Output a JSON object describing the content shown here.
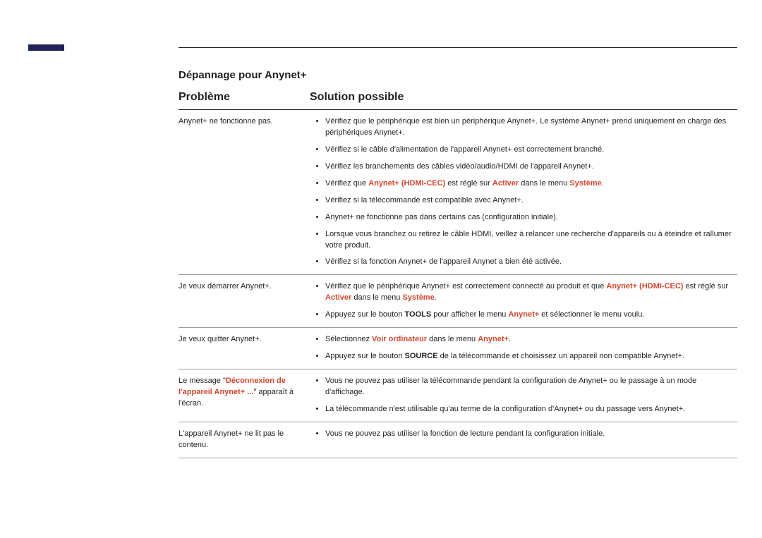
{
  "sectionTitle": "Dépannage pour Anynet+",
  "headers": {
    "problem": "Problème",
    "solution": "Solution possible"
  },
  "rows": [
    {
      "problem": [
        {
          "t": "Anynet+ ne fonctionne pas."
        }
      ],
      "solutions": [
        [
          {
            "t": "Vérifiez que le périphérique est bien un périphérique Anynet+. Le système Anynet+ prend uniquement en charge des périphériques Anynet+."
          }
        ],
        [
          {
            "t": "Vérifiez si le câble d'alimentation de l'appareil Anynet+ est correctement branché."
          }
        ],
        [
          {
            "t": "Vérifiez les branchements des câbles vidéo/audio/HDMI de l'appareil Anynet+."
          }
        ],
        [
          {
            "t": "Vérifiez que "
          },
          {
            "t": "Anynet+ (HDMI-CEC)",
            "hl": true
          },
          {
            "t": " est réglé sur "
          },
          {
            "t": "Activer",
            "hl": true
          },
          {
            "t": " dans le menu "
          },
          {
            "t": "Système",
            "hl": true
          },
          {
            "t": "."
          }
        ],
        [
          {
            "t": "Vérifiez si la télécommande est compatible avec Anynet+."
          }
        ],
        [
          {
            "t": "Anynet+ ne fonctionne pas dans certains cas (configuration initiale)."
          }
        ],
        [
          {
            "t": "Lorsque vous branchez ou retirez le câble HDMI, veillez à relancer une recherche d'appareils ou à éteindre et rallumer votre produit."
          }
        ],
        [
          {
            "t": "Vérifiez si la fonction Anynet+ de l'appareil Anynet a bien été activée."
          }
        ]
      ]
    },
    {
      "problem": [
        {
          "t": "Je veux démarrer Anynet+."
        }
      ],
      "solutions": [
        [
          {
            "t": "Vérifiez que le périphérique Anynet+ est correctement connecté au produit et que "
          },
          {
            "t": "Anynet+ (HDMI-CEC)",
            "hl": true
          },
          {
            "t": " est réglé sur "
          },
          {
            "t": "Activer",
            "hl": true
          },
          {
            "t": " dans le menu "
          },
          {
            "t": "Système",
            "hl": true
          },
          {
            "t": "."
          }
        ],
        [
          {
            "t": "Appuyez sur le bouton "
          },
          {
            "t": "TOOLS",
            "bold": true
          },
          {
            "t": " pour afficher le menu "
          },
          {
            "t": "Anynet+",
            "hl": true
          },
          {
            "t": " et sélectionner le menu voulu."
          }
        ]
      ]
    },
    {
      "problem": [
        {
          "t": "Je veux quitter Anynet+."
        }
      ],
      "solutions": [
        [
          {
            "t": "Sélectionnez "
          },
          {
            "t": "Voir ordinateur",
            "hl": true
          },
          {
            "t": " dans le menu "
          },
          {
            "t": "Anynet+",
            "hl": true
          },
          {
            "t": "."
          }
        ],
        [
          {
            "t": "Appuyez sur le bouton "
          },
          {
            "t": "SOURCE",
            "bold": true
          },
          {
            "t": " de la télécommande et choisissez un appareil non compatible Anynet+."
          }
        ]
      ]
    },
    {
      "problem": [
        {
          "t": "Le message \""
        },
        {
          "t": "Déconnexion de l'appareil Anynet+ ...",
          "hl": true
        },
        {
          "t": "\" apparaît à l'écran."
        }
      ],
      "solutions": [
        [
          {
            "t": "Vous ne pouvez pas utiliser la télécommande pendant la configuration de Anynet+ ou le passage à un mode d'affichage."
          }
        ],
        [
          {
            "t": "La télécommande n'est utilisable qu'au terme de la configuration d'Anynet+ ou du passage vers Anynet+."
          }
        ]
      ]
    },
    {
      "problem": [
        {
          "t": "L'appareil Anynet+ ne lit pas le contenu."
        }
      ],
      "solutions": [
        [
          {
            "t": "Vous ne pouvez pas utiliser la fonction de lecture pendant la configuration initiale."
          }
        ]
      ]
    }
  ]
}
